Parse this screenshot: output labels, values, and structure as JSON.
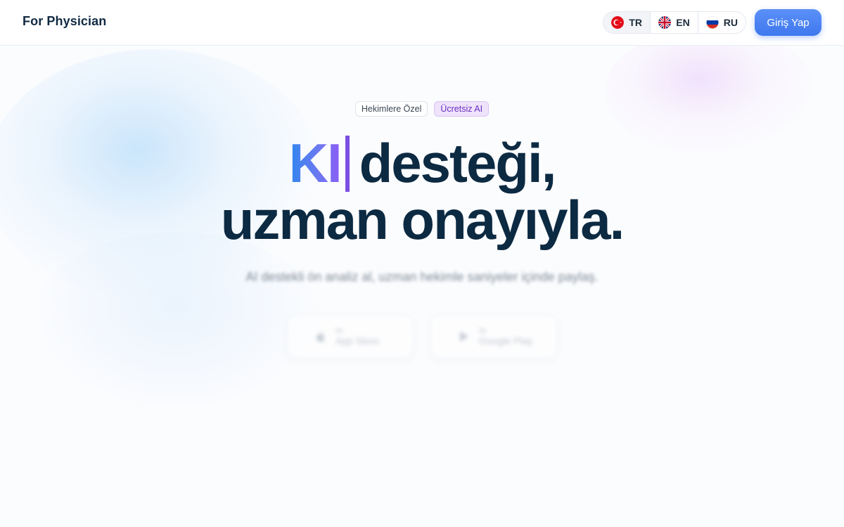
{
  "header": {
    "brand": "For Physician",
    "languages": [
      {
        "code": "TR",
        "flag": "turkey-flag-icon",
        "active": true
      },
      {
        "code": "EN",
        "flag": "uk-flag-icon",
        "active": false
      },
      {
        "code": "RU",
        "flag": "russia-flag-icon",
        "active": false
      }
    ],
    "login_label": "Giriş Yap"
  },
  "hero": {
    "badges": [
      "Hekimlere Özel",
      "Ücretsiz AI"
    ],
    "headline_accent": "KI",
    "headline_rest": "desteği,",
    "headline_line2": "uzman onayıyla.",
    "subtitle": "AI destekli ön analiz al, uzman hekimle saniyeler içinde paylaş."
  },
  "stores": [
    {
      "small": "ile",
      "big": "App Store",
      "icon": "apple-icon"
    },
    {
      "small": "ile",
      "big": "Google Play",
      "icon": "play-store-icon"
    }
  ],
  "colors": {
    "accent": "#3f78ef",
    "headline": "#0c2a42",
    "ai_badge_text": "#6a2fc0",
    "caret": "#7b4fe2"
  }
}
